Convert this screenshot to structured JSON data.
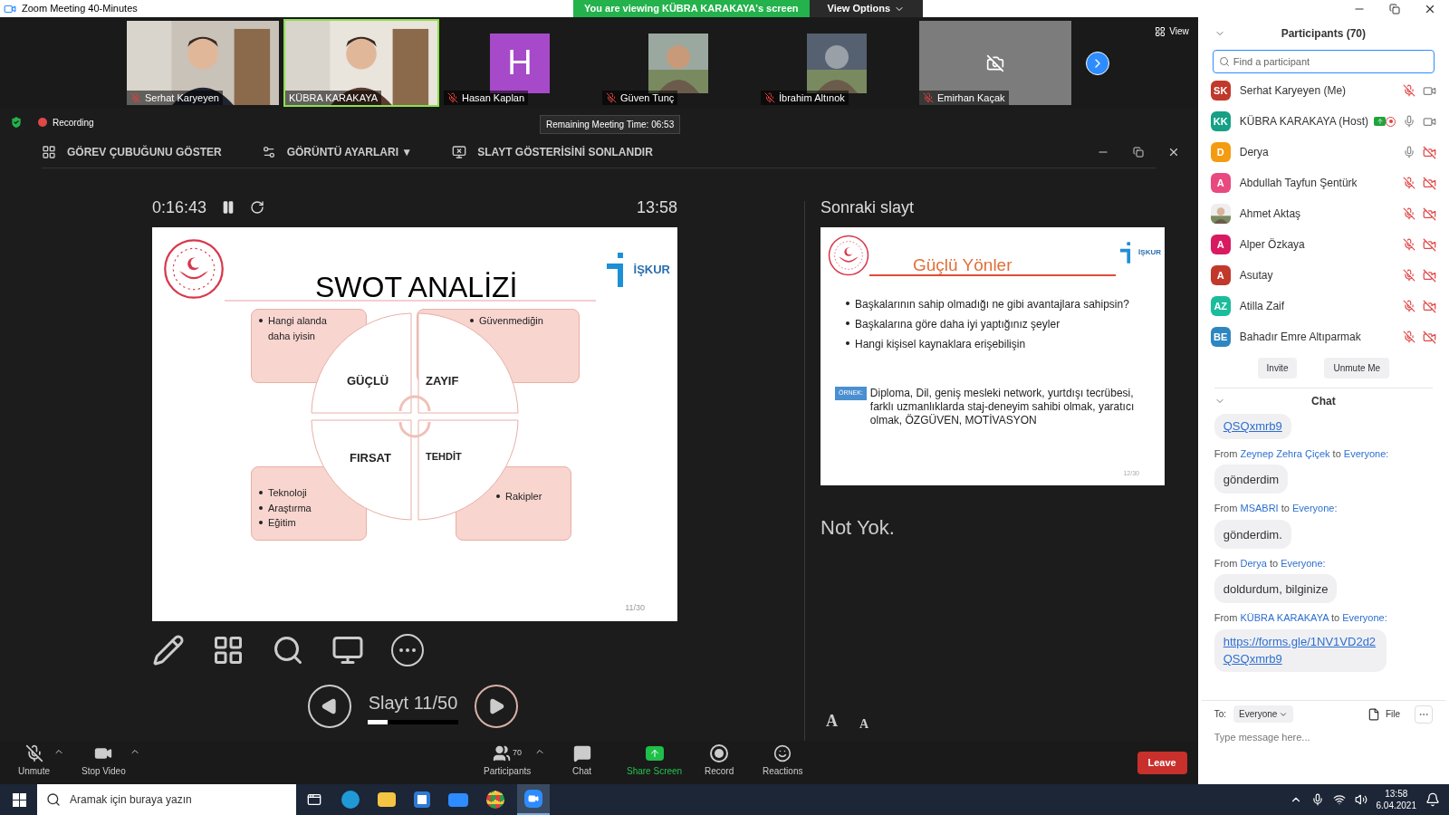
{
  "window": {
    "title": "Zoom Meeting 40-Minutes"
  },
  "banner": {
    "text": "You are viewing KÜBRA KARAKAYA's screen",
    "button": "View Options"
  },
  "video_strip": {
    "view_button": "View",
    "tiles": [
      {
        "name": "Serhat Karyeyen",
        "kind": "video",
        "muted": true,
        "selected": false
      },
      {
        "name": "KÜBRA KARAKAYA",
        "kind": "video",
        "selected": true
      },
      {
        "name": "Hasan Kaplan",
        "kind": "letter",
        "letter": "H",
        "muted": true,
        "selected": false
      },
      {
        "name": "Güven Tunç",
        "muted": true,
        "selected": false
      },
      {
        "name": "İbrahim Altınok",
        "muted": true,
        "selected": false
      },
      {
        "name": "Emirhan Kaçak",
        "kind": "camera_off",
        "muted": true,
        "selected": false
      }
    ]
  },
  "status": {
    "recording": "Recording",
    "remaining": "Remaining Meeting Time: 06:53"
  },
  "presenter_toolbar": [
    {
      "kind": "taskbar",
      "label": "GÖREV ÇUBUĞUNU GÖSTER"
    },
    {
      "kind": "display",
      "label": "GÖRÜNTÜ AYARLARI ▼"
    },
    {
      "kind": "end",
      "label": "SLAYT GÖSTERİSİNİ SONLANDIR"
    }
  ],
  "presenter": {
    "elapsed": "0:16:43",
    "clock": "13:58",
    "next_label": "Sonraki slayt",
    "notes": "Not Yok.",
    "slide_counter": "Slayt 11/50",
    "level": 0.22,
    "font_buttons": [
      "A",
      "A"
    ]
  },
  "current_slide": {
    "title": "SWOT ANALİZİ",
    "logo_text": "İŞKUR",
    "page": "11/30",
    "quadrants": [
      {
        "label": "GÜÇLÜ",
        "bullets": [
          "Hangi alanda daha iyisin"
        ]
      },
      {
        "label": "ZAYIF",
        "bullets": [
          "Güvenmediğin"
        ]
      },
      {
        "label": "FIRSAT",
        "bullets": [
          "Teknoloji",
          "Araştırma",
          "Eğitim"
        ]
      },
      {
        "label": "TEHDİT",
        "bullets": [
          "Rakipler"
        ]
      }
    ]
  },
  "next_slide": {
    "title": "Güçlü Yönler",
    "logo_text": "İŞKUR",
    "page": "12/30",
    "bullets": [
      "Başkalarının sahip olmadığı ne gibi avantajlara sahipsin?",
      "Başkalarına göre daha iyi yaptığınız şeyler",
      "Hangi kişisel kaynaklara erişebilişin"
    ],
    "example_tag": "ÖRNEK:",
    "example": "Diploma, Dil, geniş mesleki network, yurtdışı tecrübesi, farklı uzmanlıklarda staj-deneyim sahibi olmak, yaratıcı olmak, ÖZGÜVEN, MOTİVASYON"
  },
  "meeting_controls": [
    {
      "kind": "mic_off",
      "label": "Unmute",
      "caret": true
    },
    {
      "kind": "video",
      "label": "Stop Video",
      "caret": true
    },
    {
      "kind": "participants",
      "label": "Participants",
      "count": "70",
      "caret": true
    },
    {
      "kind": "chat",
      "label": "Chat"
    },
    {
      "kind": "share",
      "label": "Share Screen"
    },
    {
      "kind": "record",
      "label": "Record"
    },
    {
      "kind": "reactions",
      "label": "Reactions"
    }
  ],
  "leave_button": "Leave",
  "participants_panel": {
    "title": "Participants (70)",
    "search_placeholder": "Find a participant",
    "buttons": [
      "Invite",
      "Unmute Me"
    ],
    "rows": [
      {
        "kind": "initials",
        "initials": "SK",
        "color": "#c0392b",
        "name": "Serhat Karyeyen (Me)",
        "mic_muted": true,
        "video_off": false
      },
      {
        "kind": "initials",
        "initials": "KK",
        "color": "#16a085",
        "name": "KÜBRA KARAKAYA (Host)",
        "mic_muted": false,
        "video_off": false,
        "sharing": true,
        "recording": true
      },
      {
        "kind": "initials",
        "initials": "D",
        "color": "#f39c12",
        "name": "Derya",
        "mic_muted": false,
        "video_off": true
      },
      {
        "kind": "initials",
        "initials": "A",
        "color": "#e84a7f",
        "name": "Abdullah Tayfun Şentürk",
        "mic_muted": true,
        "video_off": true
      },
      {
        "name": "Ahmet Aktaş",
        "mic_muted": true,
        "video_off": true
      },
      {
        "kind": "initials",
        "initials": "A",
        "color": "#d81b60",
        "name": "Alper Özkaya",
        "mic_muted": true,
        "video_off": true
      },
      {
        "kind": "initials",
        "initials": "A",
        "color": "#c0392b",
        "name": "Asutay",
        "mic_muted": true,
        "video_off": true
      },
      {
        "kind": "initials",
        "initials": "AZ",
        "color": "#1abc9c",
        "name": "Atilla Zaif",
        "mic_muted": true,
        "video_off": true
      },
      {
        "kind": "initials",
        "initials": "BE",
        "color": "#2e86c1",
        "name": "Bahadır Emre Altıparmak",
        "mic_muted": true,
        "video_off": true
      }
    ]
  },
  "chat": {
    "title": "Chat",
    "messages": [
      {
        "kind": "link",
        "text": "QSQxmrb9"
      },
      {
        "kind": "text",
        "prefix": "From",
        "sender": "Zeynep Zehra Çiçek",
        "joiner": "to",
        "recipient": "Everyone:",
        "text": "gönderdim"
      },
      {
        "kind": "text",
        "prefix": "From",
        "sender": "MSABRI",
        "joiner": "to",
        "recipient": "Everyone:",
        "text": "gönderdim."
      },
      {
        "kind": "text",
        "prefix": "From",
        "sender": "Derya",
        "joiner": "to",
        "recipient": "Everyone:",
        "text": "doldurdum, bilginize"
      },
      {
        "kind": "link",
        "prefix": "From",
        "sender": "KÜBRA KARAKAYA",
        "joiner": "to",
        "recipient": "Everyone:",
        "text": "https://forms.gle/1NV1VD2d2QSQxmrb9"
      }
    ],
    "composer": {
      "to_label": "To:",
      "to_value": "Everyone",
      "file": "File",
      "placeholder": "Type message here..."
    }
  },
  "taskbar": {
    "search_placeholder": "Aramak için buraya yazın",
    "time": "13:58",
    "date": "6.04.2021"
  }
}
